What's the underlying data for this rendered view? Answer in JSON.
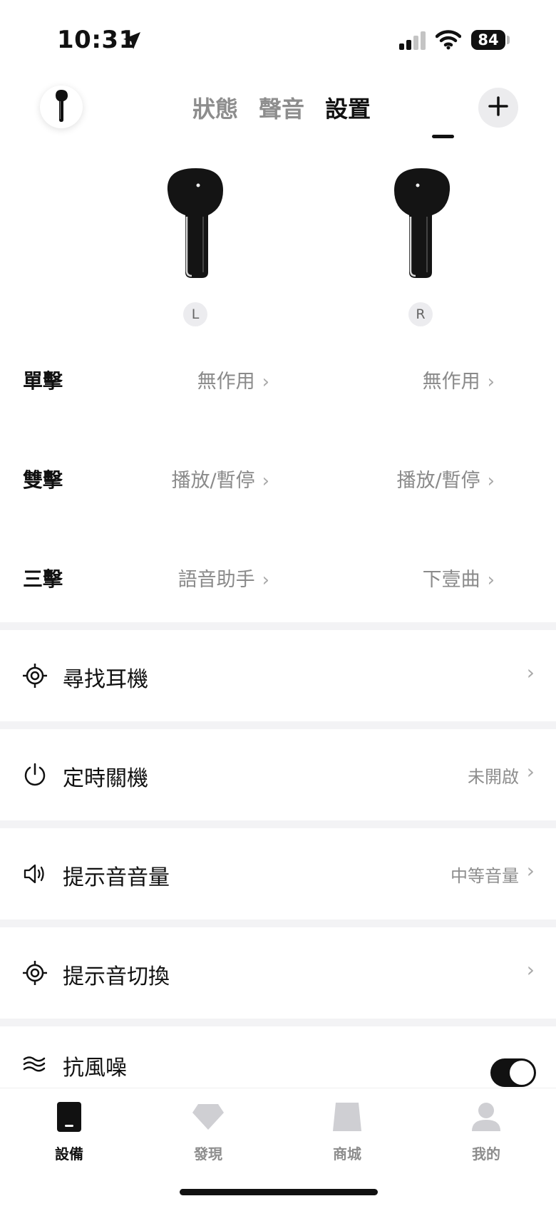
{
  "status_bar": {
    "time": "10:31",
    "battery": "84"
  },
  "header": {
    "tabs": [
      {
        "label": "狀態",
        "active": false
      },
      {
        "label": "聲音",
        "active": false
      },
      {
        "label": "設置",
        "active": true
      }
    ]
  },
  "earbuds": {
    "left_badge": "L",
    "right_badge": "R"
  },
  "gestures": [
    {
      "label": "單擊",
      "left_value": "無作用",
      "right_value": "無作用"
    },
    {
      "label": "雙擊",
      "left_value": "播放/暫停",
      "right_value": "播放/暫停"
    },
    {
      "label": "三擊",
      "left_value": "語音助手",
      "right_value": "下壹曲"
    }
  ],
  "settings": [
    {
      "label": "尋找耳機",
      "value": "",
      "icon": "target-icon"
    },
    {
      "label": "定時關機",
      "value": "未開啟",
      "icon": "power-icon"
    },
    {
      "label": "提示音音量",
      "value": "中等音量",
      "icon": "speaker-icon"
    },
    {
      "label": "提示音切換",
      "value": "",
      "icon": "target-icon"
    },
    {
      "label": "抗風噪",
      "toggle_on": true,
      "icon": "wind-icon"
    }
  ],
  "bottom_nav": [
    {
      "label": "設備",
      "active": true,
      "icon": "device-icon"
    },
    {
      "label": "發現",
      "active": false,
      "icon": "diamond-icon"
    },
    {
      "label": "商城",
      "active": false,
      "icon": "store-icon"
    },
    {
      "label": "我的",
      "active": false,
      "icon": "profile-icon"
    }
  ],
  "colors": {
    "accent": "#111111",
    "muted_text": "#8d8d8d",
    "separator": "#f3f3f5"
  }
}
